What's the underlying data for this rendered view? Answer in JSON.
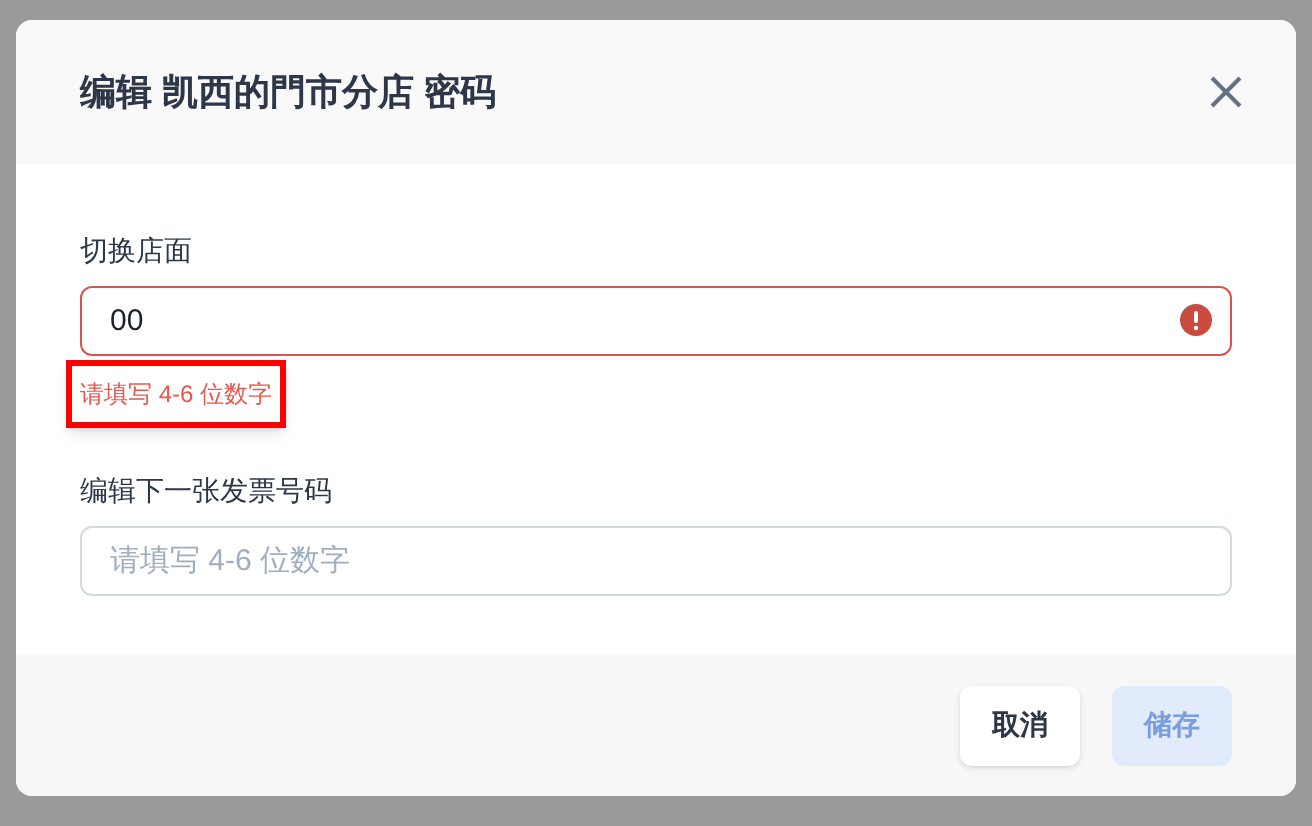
{
  "dialog": {
    "title": "编辑 凯西的門市分店 密码"
  },
  "fields": [
    {
      "label": "切换店面",
      "value": "00",
      "invalid": true,
      "error": "请填写 4-6 位数字",
      "error_highlighted": true
    },
    {
      "label": "编辑下一张发票号码",
      "placeholder": "请填写 4-6 位数字",
      "invalid": false
    }
  ],
  "buttons": [
    {
      "label": "取消",
      "disabled": false
    },
    {
      "label": "储存",
      "disabled": true
    }
  ]
}
